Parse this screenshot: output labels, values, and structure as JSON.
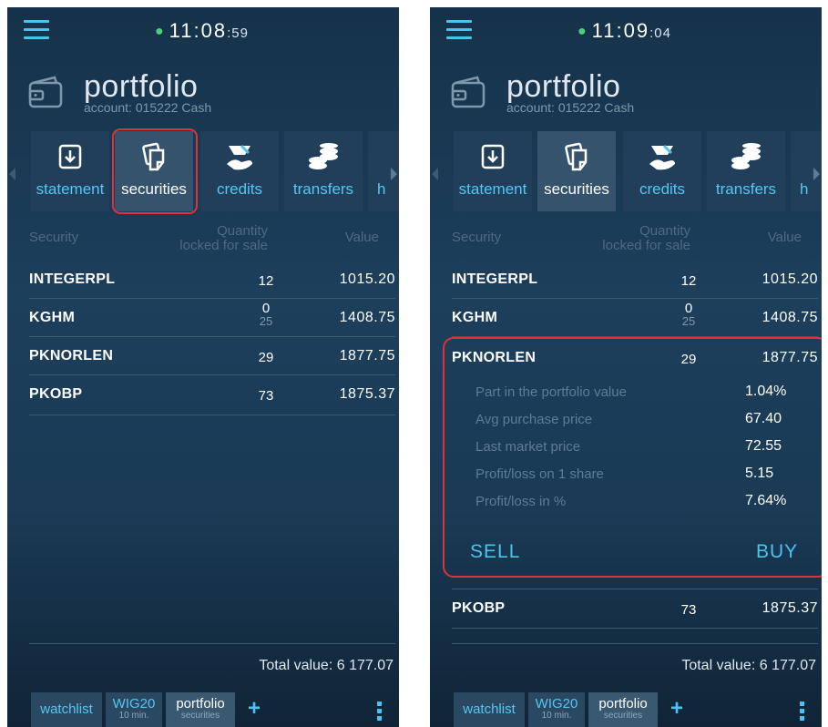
{
  "left": {
    "clock_main": "11:08",
    "clock_sec": ":59",
    "title": "portfolio",
    "account": "account: 015222 Cash",
    "tabs": [
      {
        "label": "statement",
        "icon": "statement-icon"
      },
      {
        "label": "securities",
        "icon": "securities-icon"
      },
      {
        "label": "credits",
        "icon": "credits-icon"
      },
      {
        "label": "transfers",
        "icon": "transfers-icon"
      },
      {
        "label": "h",
        "icon": ""
      }
    ],
    "headers": {
      "security": "Security",
      "quantity": "Quantity",
      "locked": "locked for sale",
      "value": "Value"
    },
    "rows": [
      {
        "symbol": "INTEGERPL",
        "qty": "12",
        "locked": "",
        "value": "1015.20"
      },
      {
        "symbol": "KGHM",
        "qty": "0",
        "locked": "25",
        "value": "1408.75"
      },
      {
        "symbol": "PKNORLEN",
        "qty": "29",
        "locked": "",
        "value": "1877.75"
      },
      {
        "symbol": "PKOBP",
        "qty": "73",
        "locked": "",
        "value": "1875.37"
      }
    ],
    "total_label": "Total value:",
    "total_value": "6 177.07",
    "bottom_tabs": [
      {
        "label": "watchlist",
        "sub": ""
      },
      {
        "label": "WIG20",
        "sub": "10 min."
      },
      {
        "label": "portfolio",
        "sub": "securities"
      }
    ],
    "plus": "+"
  },
  "right": {
    "clock_main": "11:09",
    "clock_sec": ":04",
    "title": "portfolio",
    "account": "account: 015222 Cash",
    "tabs": [
      {
        "label": "statement"
      },
      {
        "label": "securities"
      },
      {
        "label": "credits"
      },
      {
        "label": "transfers"
      },
      {
        "label": "h"
      }
    ],
    "headers": {
      "security": "Security",
      "quantity": "Quantity",
      "locked": "locked for sale",
      "value": "Value"
    },
    "rows": [
      {
        "symbol": "INTEGERPL",
        "qty": "12",
        "locked": "",
        "value": "1015.20"
      },
      {
        "symbol": "KGHM",
        "qty": "0",
        "locked": "25",
        "value": "1408.75"
      },
      {
        "symbol": "PKNORLEN",
        "qty": "29",
        "locked": "",
        "value": "1877.75"
      },
      {
        "symbol": "PKOBP",
        "qty": "73",
        "locked": "",
        "value": "1875.37"
      }
    ],
    "details": [
      {
        "label": "Part in the portfolio value",
        "value": "1.04%"
      },
      {
        "label": "Avg purchase price",
        "value": "67.40"
      },
      {
        "label": "Last market price",
        "value": "72.55"
      },
      {
        "label": "Profit/loss on 1 share",
        "value": "5.15"
      },
      {
        "label": "Profit/loss in %",
        "value": "7.64%"
      }
    ],
    "sell": "SELL",
    "buy": "BUY",
    "total_label": "Total value:",
    "total_value": "6 177.07",
    "bottom_tabs": [
      {
        "label": "watchlist",
        "sub": ""
      },
      {
        "label": "WIG20",
        "sub": "10 min."
      },
      {
        "label": "portfolio",
        "sub": "securities"
      }
    ],
    "plus": "+"
  },
  "colors": {
    "accent": "#4cc3ef",
    "highlight": "#e0313b",
    "online": "#49d07c",
    "background": "#1c3f5c"
  }
}
